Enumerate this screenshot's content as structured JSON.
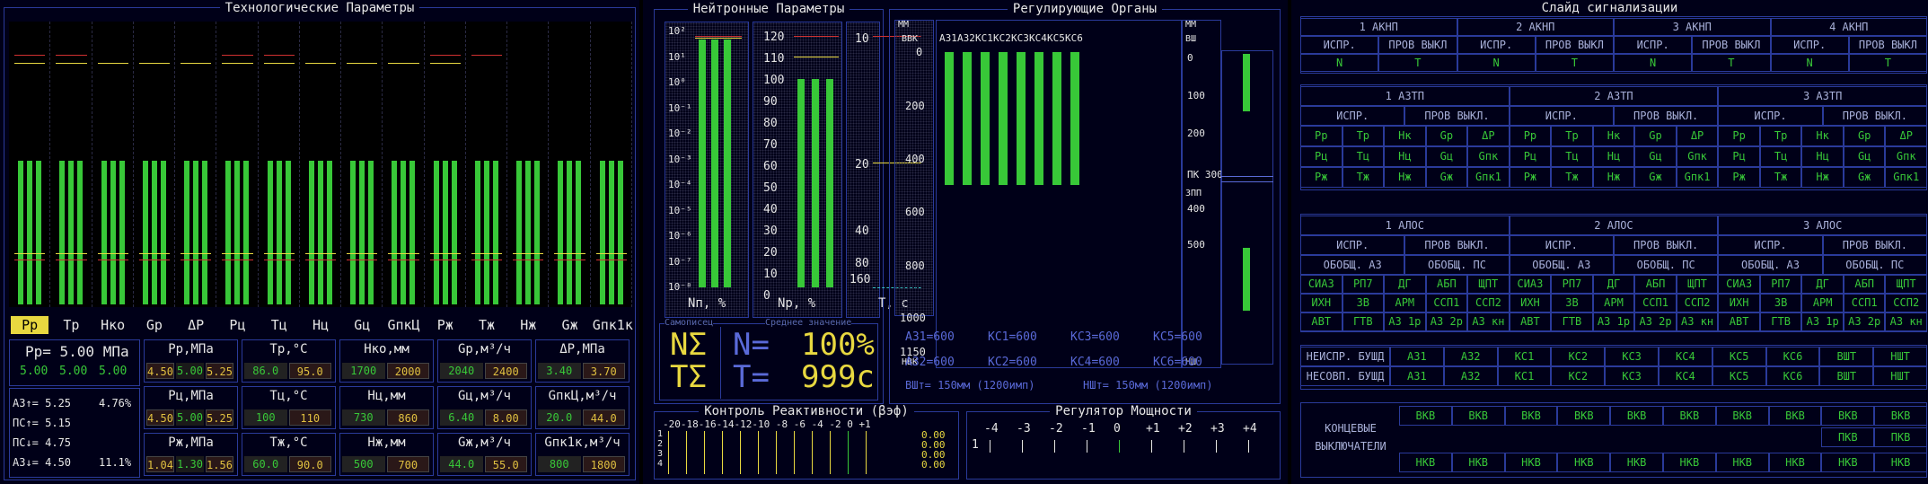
{
  "colors": {
    "green": "#38c838",
    "yellow": "#e8d840",
    "red": "#d03030",
    "frame": "#2a3a9a",
    "text": "#e6e6e6"
  },
  "tech": {
    "title": "Технологические Параметры",
    "tabs": [
      "Рр",
      "Тр",
      "Нко",
      "Gр",
      "ΔР",
      "Рц",
      "Тц",
      "Нц",
      "Gц",
      "GпкЦ",
      "Рж",
      "Тж",
      "Нж",
      "Gж",
      "Gпк1к"
    ],
    "selected_tab": "Рр",
    "pressure": {
      "label": "Рр= 5.00 МПа",
      "v1": "5.00",
      "v2": "5.00",
      "v3": "5.00"
    },
    "setpoints": [
      {
        "k": "АЗ↑= 5.25",
        "pct": "4.76%"
      },
      {
        "k": "ПС↑= 5.15",
        "pct": ""
      },
      {
        "k": "ПС↓= 4.75",
        "pct": ""
      },
      {
        "k": "АЗ↓= 4.50",
        "pct": "11.1%"
      }
    ],
    "params": [
      {
        "name": "Рр,МПа",
        "vals": [
          "4.50",
          "5.00",
          "5.25"
        ]
      },
      {
        "name": "Тр,°С",
        "vals": [
          "86.0",
          "95.0"
        ]
      },
      {
        "name": "Нко,мм",
        "vals": [
          "1700",
          "2000"
        ]
      },
      {
        "name": "Gр,м³/ч",
        "vals": [
          "2040",
          "2400"
        ]
      },
      {
        "name": "ΔР,МПа",
        "vals": [
          "3.40",
          "3.70"
        ]
      },
      {
        "name": "Рц,МПа",
        "vals": [
          "4.50",
          "5.00",
          "5.25"
        ]
      },
      {
        "name": "Тц,°С",
        "vals": [
          "100",
          "110"
        ]
      },
      {
        "name": "Нц,мм",
        "vals": [
          "730",
          "860"
        ]
      },
      {
        "name": "Gц,м³/ч",
        "vals": [
          "6.40",
          "8.00"
        ]
      },
      {
        "name": "GпкЦ,м³/ч",
        "vals": [
          "20.0",
          "44.0"
        ]
      },
      {
        "name": "Рж,МПа",
        "vals": [
          "1.04",
          "1.30",
          "1.56"
        ]
      },
      {
        "name": "Тж,°С",
        "vals": [
          "60.0",
          "90.0"
        ]
      },
      {
        "name": "Нж,мм",
        "vals": [
          "500",
          "700"
        ]
      },
      {
        "name": "Gж,м³/ч",
        "vals": [
          "44.0",
          "55.0"
        ]
      },
      {
        "name": "Gпк1к,м³/ч",
        "vals": [
          "800",
          "1800"
        ]
      }
    ]
  },
  "neutron": {
    "title": "Нейтронные Параметры",
    "log_ticks": [
      "10²",
      "10¹",
      "10⁰",
      "10⁻¹",
      "10⁻²",
      "10⁻³",
      "10⁻⁴",
      "10⁻⁵",
      "10⁻⁶",
      "10⁻⁷",
      "10⁻⁸"
    ],
    "pct_ticks": [
      "120",
      "110",
      "100",
      "90",
      "80",
      "70",
      "60",
      "50",
      "40",
      "30",
      "20",
      "10",
      "0"
    ],
    "t_ticks": [
      "10",
      "20",
      "40",
      "80",
      "160"
    ],
    "label_np": "Nп, %",
    "label_nr": "Nр, %",
    "label_t": "Т, с",
    "samopis": "Самописец",
    "avg": "Среднее значение",
    "ns": "NΣ",
    "ts": "ТΣ",
    "neq": "N=",
    "teq": "Т=",
    "nval": "100%",
    "tval": "999с"
  },
  "rods": {
    "title": "Регулирующие Органы",
    "mm": "ММ",
    "vvk": "ВВК",
    "nvk": "НВК",
    "vsh": "ВШ",
    "nsh": "НШ",
    "pk": "ПК",
    "zpp": "ЗПП",
    "rods": [
      "АЗ1",
      "АЗ2",
      "КС1",
      "КС2",
      "КС3",
      "КС4",
      "КС5",
      "КС6"
    ],
    "ticks": [
      "0",
      "200",
      "400",
      "600",
      "800",
      "1000",
      "1150"
    ],
    "right_ticks": [
      "0",
      "100",
      "200",
      "ПК 300",
      "400",
      "500"
    ],
    "positions": {
      "AZ1": "АЗ1=600",
      "AZ2": "АЗ2=600",
      "KS1": "КС1=600",
      "KS2": "КС2=600",
      "KS3": "КС3=600",
      "KS4": "КС4=600",
      "KS5": "КС5=600",
      "KS6": "КС6=600",
      "VSh": "ВШт= 150мм (1200имп)",
      "NSh": "НШт= 150мм (1200имп)"
    }
  },
  "reactivity": {
    "title": "Контроль Реактивности (βэф)",
    "scale": "-20-18-16-14-12-10 -8 -6 -4 -2  0   +1",
    "rows": [
      "1",
      "2",
      "3",
      "4"
    ],
    "vals": [
      "0.00",
      "0.00",
      "0.00",
      "0.00"
    ]
  },
  "power": {
    "title": "Регулятор Мощности",
    "scale": [
      "-4",
      "-3",
      "-2",
      "-1",
      "0",
      "+1",
      "+2",
      "+3",
      "+4"
    ],
    "row": "1"
  },
  "alarm": {
    "title": "Слайд сигнализации",
    "aknp": [
      "1 АКНП",
      "2 АКНП",
      "3 АКНП",
      "4 АКНП"
    ],
    "aknp_hdr": [
      "ИСПР.",
      "ПРОВ ВЫКЛ"
    ],
    "aknp_vals": [
      "N",
      "Т"
    ],
    "aztp": [
      "1 АЗТП",
      "2 АЗТП",
      "3 АЗТП"
    ],
    "aztp_hdr": [
      "ИСПР.",
      "ПРОВ ВЫКЛ."
    ],
    "aztp_rows": [
      [
        "Рр",
        "Тр",
        "Нк",
        "Gр",
        "ΔР"
      ],
      [
        "Рц",
        "Тц",
        "Нц",
        "Gц",
        "Gпк"
      ],
      [
        "Рж",
        "Тж",
        "Нж",
        "Gж",
        "Gпк1"
      ]
    ],
    "alos": [
      "1 АЛОС",
      "2 АЛОС",
      "3 АЛОС"
    ],
    "alos_hdr": [
      "ИСПР.",
      "ПРОВ ВЫКЛ."
    ],
    "alos_hdr2": [
      "ОБОБЩ. АЗ",
      "ОБОБЩ. ПС"
    ],
    "alos_rows": [
      [
        "СИАЗ",
        "РП7",
        "ДГ",
        "АБП",
        "ЩПТ"
      ],
      [
        "ИХН",
        "ЗВ",
        "АРМ",
        "ССП1",
        "ССП2"
      ],
      [
        "АВТ",
        "ГТВ",
        "АЗ 1р",
        "АЗ 2р",
        "АЗ кн"
      ]
    ],
    "bushd": [
      {
        "label": "НЕИСПР. БУШД",
        "items": [
          "АЗ1",
          "АЗ2",
          "КС1",
          "КС2",
          "КС3",
          "КС4",
          "КС5",
          "КС6",
          "ВШТ",
          "НШТ"
        ]
      },
      {
        "label": "НЕСОВП. БУШД",
        "items": [
          "АЗ1",
          "АЗ2",
          "КС1",
          "КС2",
          "КС3",
          "КС4",
          "КС5",
          "КС6",
          "ВШТ",
          "НШТ"
        ]
      }
    ],
    "limit_label1": "КОНЦЕВЫЕ",
    "limit_label2": "ВЫКЛЮЧАТЕЛИ",
    "vkv": "ВКВ",
    "pkv": "ПКВ",
    "nkv": "НКВ"
  }
}
